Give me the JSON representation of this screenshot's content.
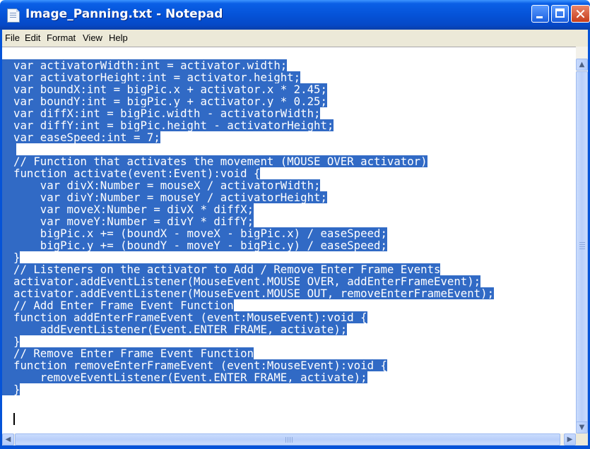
{
  "window": {
    "title": "Image_Panning.txt - Notepad",
    "icon": "notepad-icon",
    "controls": {
      "minimize": "minimize-icon",
      "maximize": "maximize-icon",
      "close": "close-icon"
    },
    "close_glyph": "✕"
  },
  "menu": [
    "File",
    "Edit",
    "Format",
    "View",
    "Help"
  ],
  "editor": {
    "selection_color": "#316ac5",
    "lines": [
      "var activatorWidth:int = activator.width;",
      "var activatorHeight:int = activator.height;",
      "var boundX:int = bigPic.x + activator.x * 2.45;",
      "var boundY:int = bigPic.y + activator.y * 0.25;",
      "var diffX:int = bigPic.width - activatorWidth;",
      "var diffY:int = bigPic.height - activatorHeight;",
      "var easeSpeed:int = 7;",
      "",
      "// Function that activates the movement (MOUSE_OVER activator)",
      "function activate(event:Event):void {",
      "    var divX:Number = mouseX / activatorWidth;",
      "    var divY:Number = mouseY / activatorHeight;",
      "    var moveX:Number = divX * diffX;",
      "    var moveY:Number = divY * diffY;",
      "    bigPic.x += (boundX - moveX - bigPic.x) / easeSpeed;",
      "    bigPic.y += (boundY - moveY - bigPic.y) / easeSpeed;",
      "}",
      "// Listeners on the activator to Add / Remove Enter Frame Events",
      "activator.addEventListener(MouseEvent.MOUSE_OVER, addEnterFrameEvent);",
      "activator.addEventListener(MouseEvent.MOUSE_OUT, removeEnterFrameEvent);",
      "// Add Enter Frame Event Function",
      "function addEnterFrameEvent (event:MouseEvent):void {",
      "    addEventListener(Event.ENTER_FRAME, activate);",
      "}",
      "// Remove Enter Frame Event Function",
      "function removeEnterFrameEvent (event:MouseEvent):void {",
      "    removeEventListener(Event.ENTER_FRAME, activate);",
      "}"
    ]
  },
  "scrollbars": {
    "vertical": {
      "up": "▲",
      "down": "▼",
      "up_icon": "scroll-up-arrow-icon",
      "down_icon": "scroll-down-arrow-icon"
    },
    "horizontal": {
      "left": "◀",
      "right": "▶",
      "left_icon": "scroll-left-arrow-icon",
      "right_icon": "scroll-right-arrow-icon"
    }
  }
}
